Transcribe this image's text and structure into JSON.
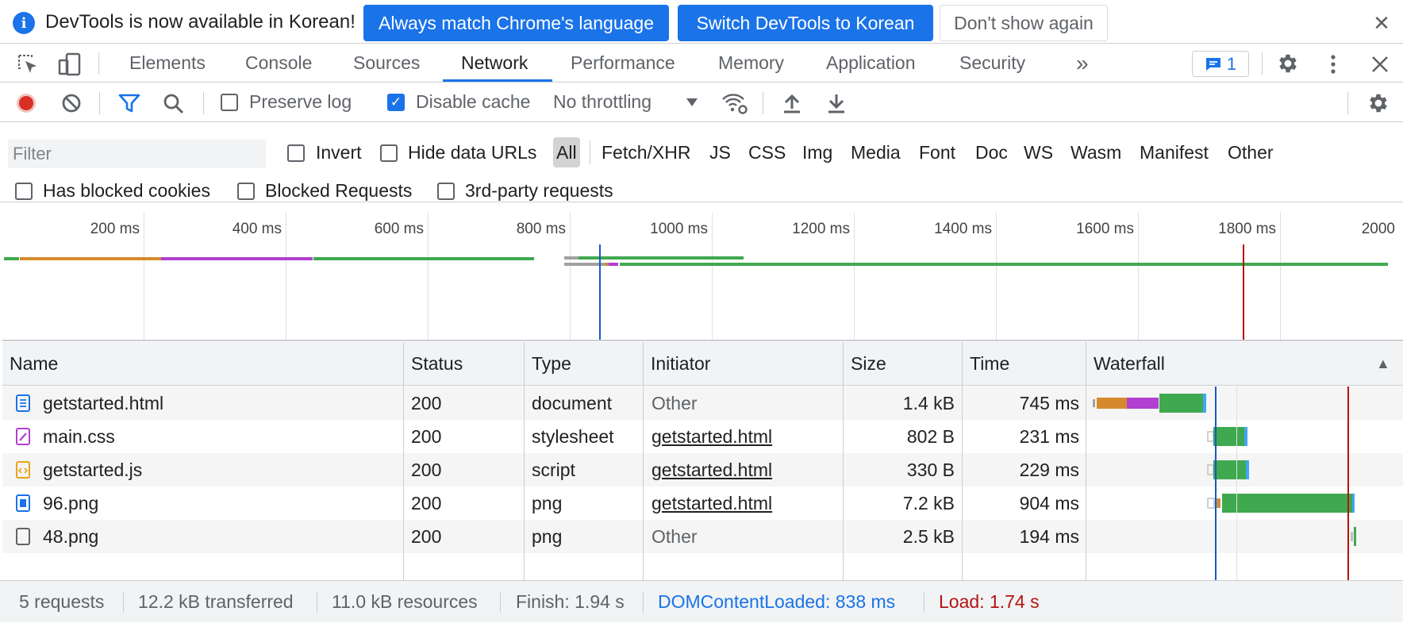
{
  "infobar": {
    "message": "DevTools is now available in Korean!",
    "btn_match": "Always match Chrome's language",
    "btn_switch": "Switch DevTools to Korean",
    "btn_dismiss": "Don't show again",
    "close": "✕"
  },
  "tabs": {
    "elements": "Elements",
    "console": "Console",
    "sources": "Sources",
    "network": "Network",
    "performance": "Performance",
    "memory": "Memory",
    "application": "Application",
    "security": "Security",
    "more": "»",
    "issues_count": "1",
    "active": "Network"
  },
  "toolbar": {
    "preserve_log": "Preserve log",
    "preserve_log_checked": false,
    "disable_cache": "Disable cache",
    "disable_cache_checked": true,
    "throttling": "No throttling"
  },
  "filter": {
    "placeholder": "Filter",
    "invert": "Invert",
    "hide_data_urls": "Hide data URLs",
    "types": [
      "All",
      "Fetch/XHR",
      "JS",
      "CSS",
      "Img",
      "Media",
      "Font",
      "Doc",
      "WS",
      "Wasm",
      "Manifest",
      "Other"
    ],
    "active_type": "All",
    "has_blocked_cookies": "Has blocked cookies",
    "blocked_requests": "Blocked Requests",
    "third_party": "3rd-party requests"
  },
  "overview": {
    "ticks": [
      "200 ms",
      "400 ms",
      "600 ms",
      "800 ms",
      "1000 ms",
      "1200 ms",
      "1400 ms",
      "1600 ms",
      "1800 ms",
      "2000"
    ]
  },
  "table": {
    "headers": {
      "name": "Name",
      "status": "Status",
      "type": "Type",
      "initiator": "Initiator",
      "size": "Size",
      "time": "Time",
      "waterfall": "Waterfall",
      "sort_indicator": "▲"
    },
    "rows": [
      {
        "name": "getstarted.html",
        "status": "200",
        "type": "document",
        "initiator": "Other",
        "size": "1.4 kB",
        "time": "745 ms",
        "icon": "document-icon"
      },
      {
        "name": "main.css",
        "status": "200",
        "type": "stylesheet",
        "initiator": "getstarted.html",
        "size": "802 B",
        "time": "231 ms",
        "icon": "stylesheet-icon"
      },
      {
        "name": "getstarted.js",
        "status": "200",
        "type": "script",
        "initiator": "getstarted.html",
        "size": "330 B",
        "time": "229 ms",
        "icon": "script-icon"
      },
      {
        "name": "96.png",
        "status": "200",
        "type": "png",
        "initiator": "getstarted.html",
        "size": "7.2 kB",
        "time": "904 ms",
        "icon": "image-icon"
      },
      {
        "name": "48.png",
        "status": "200",
        "type": "png",
        "initiator": "Other",
        "size": "2.5 kB",
        "time": "194 ms",
        "icon": "file-icon"
      }
    ]
  },
  "summary": {
    "requests": "5 requests",
    "transferred": "12.2 kB transferred",
    "resources": "11.0 kB resources",
    "finish": "Finish: 1.94 s",
    "dom_content_loaded": "DOMContentLoaded: 838 ms",
    "load": "Load: 1.74 s"
  },
  "colors": {
    "accent": "#1a73e8",
    "record": "#d93025",
    "dcl_line": "#1a57c7",
    "load_line": "#b31412",
    "wf_waiting": "#d68a2c",
    "wf_ssl": "#b13fd1",
    "wf_download": "#3fa950",
    "wf_queue": "#a0a0a0"
  }
}
